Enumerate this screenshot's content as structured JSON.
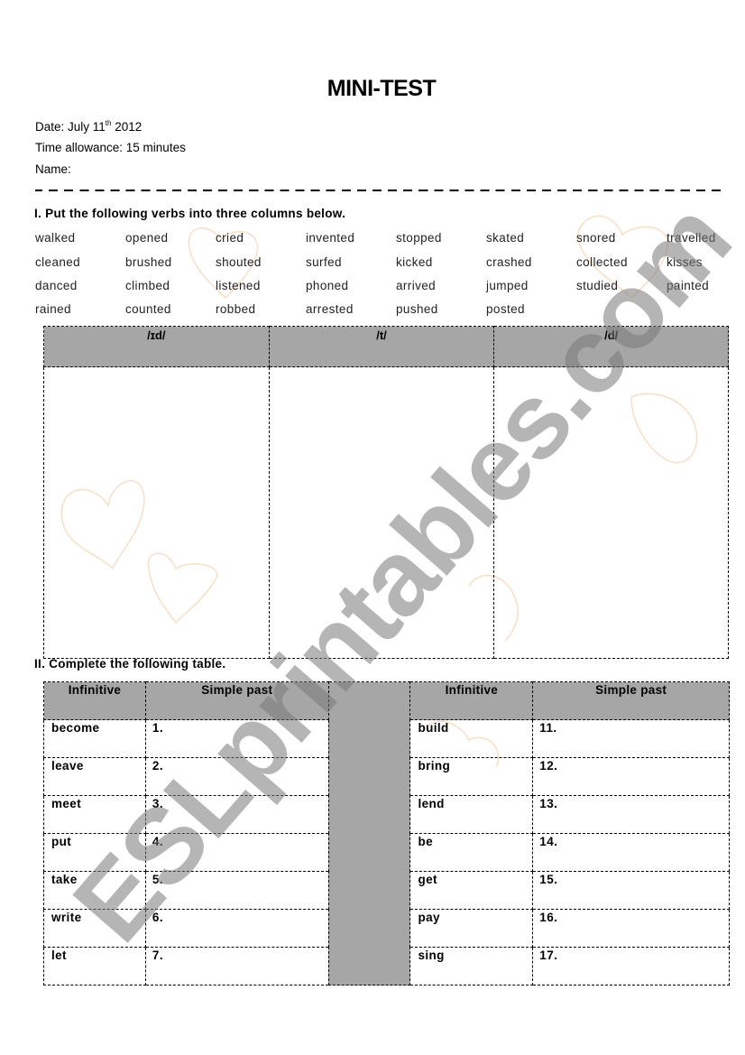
{
  "header": {
    "title": "MINI-TEST",
    "date_label": "Date: July 11",
    "date_sup": "th",
    "date_year": " 2012",
    "time_allowance": "Time allowance: 15 minutes",
    "name_label": "Name:"
  },
  "part1": {
    "instruction": "I. Put the following verbs into three columns below.",
    "verbs": [
      [
        "walked",
        "opened",
        "cried",
        "invented",
        "stopped",
        "skated",
        "snored",
        "travelled"
      ],
      [
        "cleaned",
        "brushed",
        "shouted",
        "surfed",
        "kicked",
        "crashed",
        "collected",
        "kisses"
      ],
      [
        "danced",
        "climbed",
        "listened",
        "phoned",
        "arrived",
        "jumped",
        "studied",
        "painted"
      ],
      [
        "rained",
        "counted",
        "robbed",
        "arrested",
        "pushed",
        "posted"
      ]
    ],
    "columns": [
      "/ɪd/",
      "/t/",
      "/d/"
    ]
  },
  "part2": {
    "instruction": "II. Complete the following table.",
    "headers": {
      "infinitive": "Infinitive",
      "simple_past": "Simple past"
    },
    "left_rows": [
      {
        "infinitive": "become",
        "num": "1."
      },
      {
        "infinitive": "leave",
        "num": "2."
      },
      {
        "infinitive": "meet",
        "num": "3."
      },
      {
        "infinitive": "put",
        "num": "4."
      },
      {
        "infinitive": "take",
        "num": "5."
      },
      {
        "infinitive": "write",
        "num": "6."
      },
      {
        "infinitive": "let",
        "num": "7."
      }
    ],
    "right_rows": [
      {
        "infinitive": "build",
        "num": "11."
      },
      {
        "infinitive": "bring",
        "num": "12."
      },
      {
        "infinitive": "lend",
        "num": "13."
      },
      {
        "infinitive": "be",
        "num": "14."
      },
      {
        "infinitive": "get",
        "num": "15."
      },
      {
        "infinitive": "pay",
        "num": "16."
      },
      {
        "infinitive": "sing",
        "num": "17."
      }
    ]
  },
  "watermark": "ESLprintables.com",
  "colors": {
    "header_gray": "#a6a6a6",
    "watermark_gray": "#8c8c8c",
    "heart_orange": "#f5d9b8"
  }
}
